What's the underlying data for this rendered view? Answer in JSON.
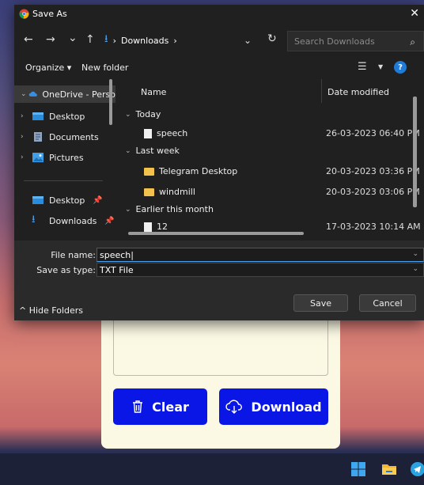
{
  "dialog": {
    "title": "Save As",
    "close_glyph": "✕",
    "nav": {
      "back": "←",
      "forward": "→",
      "recent": "⌄",
      "up": "↑"
    },
    "address": {
      "icon": "download-icon",
      "sep1": "›",
      "folder": "Downloads",
      "sep2": "›"
    },
    "search_placeholder": "Search Downloads",
    "toolbar": {
      "organize": "Organize ▾",
      "new_folder": "New folder"
    }
  },
  "sidebar": {
    "items": [
      {
        "label": "OneDrive - Perso",
        "chev": "⌄",
        "color": "#3b8de0"
      },
      {
        "label": "Desktop",
        "chev": "›",
        "color": "#2a8cdc"
      },
      {
        "label": "Documents",
        "chev": "›",
        "color": "#8fa5c4"
      },
      {
        "label": "Pictures",
        "chev": "›",
        "color": "#3fa0e8"
      },
      {
        "label": "Desktop",
        "chev": "",
        "color": "#2a8cdc"
      },
      {
        "label": "Downloads",
        "chev": "",
        "color": "#4aa3f0"
      }
    ]
  },
  "filelist": {
    "col_name": "Name",
    "col_date": "Date modified",
    "groups": [
      "Today",
      "Last week",
      "Earlier this month"
    ],
    "rows": [
      {
        "name": "speech",
        "date": "26-03-2023 06:40 PM",
        "kind": "file"
      },
      {
        "name": "Telegram Desktop",
        "date": "20-03-2023 03:36 PM",
        "kind": "folder"
      },
      {
        "name": "windmill",
        "date": "20-03-2023 03:06 PM",
        "kind": "folder"
      },
      {
        "name": "12",
        "date": "17-03-2023 10:14 AM",
        "kind": "file"
      }
    ]
  },
  "form": {
    "file_name_label": "File name:",
    "file_name_value": "speech",
    "save_type_label": "Save as type:",
    "save_type_value": "TXT File",
    "hide_folders": "Hide Folders",
    "save": "Save",
    "cancel": "Cancel"
  },
  "app": {
    "clear": "Clear",
    "download": "Download"
  }
}
